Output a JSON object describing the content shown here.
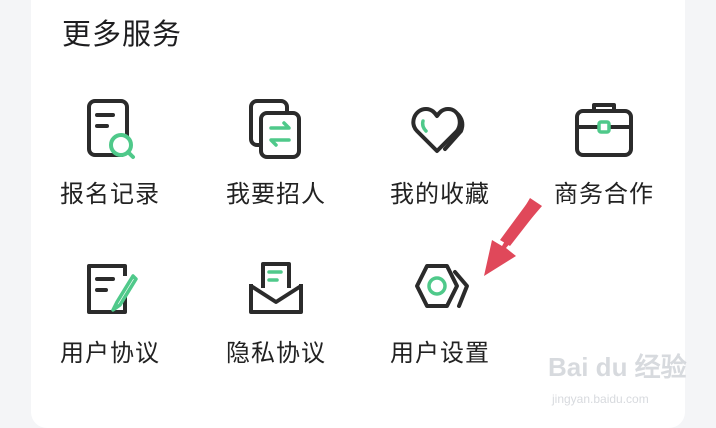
{
  "section": {
    "title": "更多服务"
  },
  "services": [
    {
      "label": "报名记录",
      "icon": "record-search-icon"
    },
    {
      "label": "我要招人",
      "icon": "recruit-swap-icon"
    },
    {
      "label": "我的收藏",
      "icon": "heart-favorite-icon"
    },
    {
      "label": "商务合作",
      "icon": "briefcase-icon"
    },
    {
      "label": "用户协议",
      "icon": "document-edit-icon"
    },
    {
      "label": "隐私协议",
      "icon": "envelope-letter-icon"
    },
    {
      "label": "用户设置",
      "icon": "hexagon-settings-icon"
    }
  ],
  "colors": {
    "accent": "#4fc98a",
    "stroke": "#2b2b2b",
    "arrow": "#e0485a"
  },
  "watermark": {
    "brand": "Bai du 经验",
    "url": "jingyan.baidu.com"
  }
}
